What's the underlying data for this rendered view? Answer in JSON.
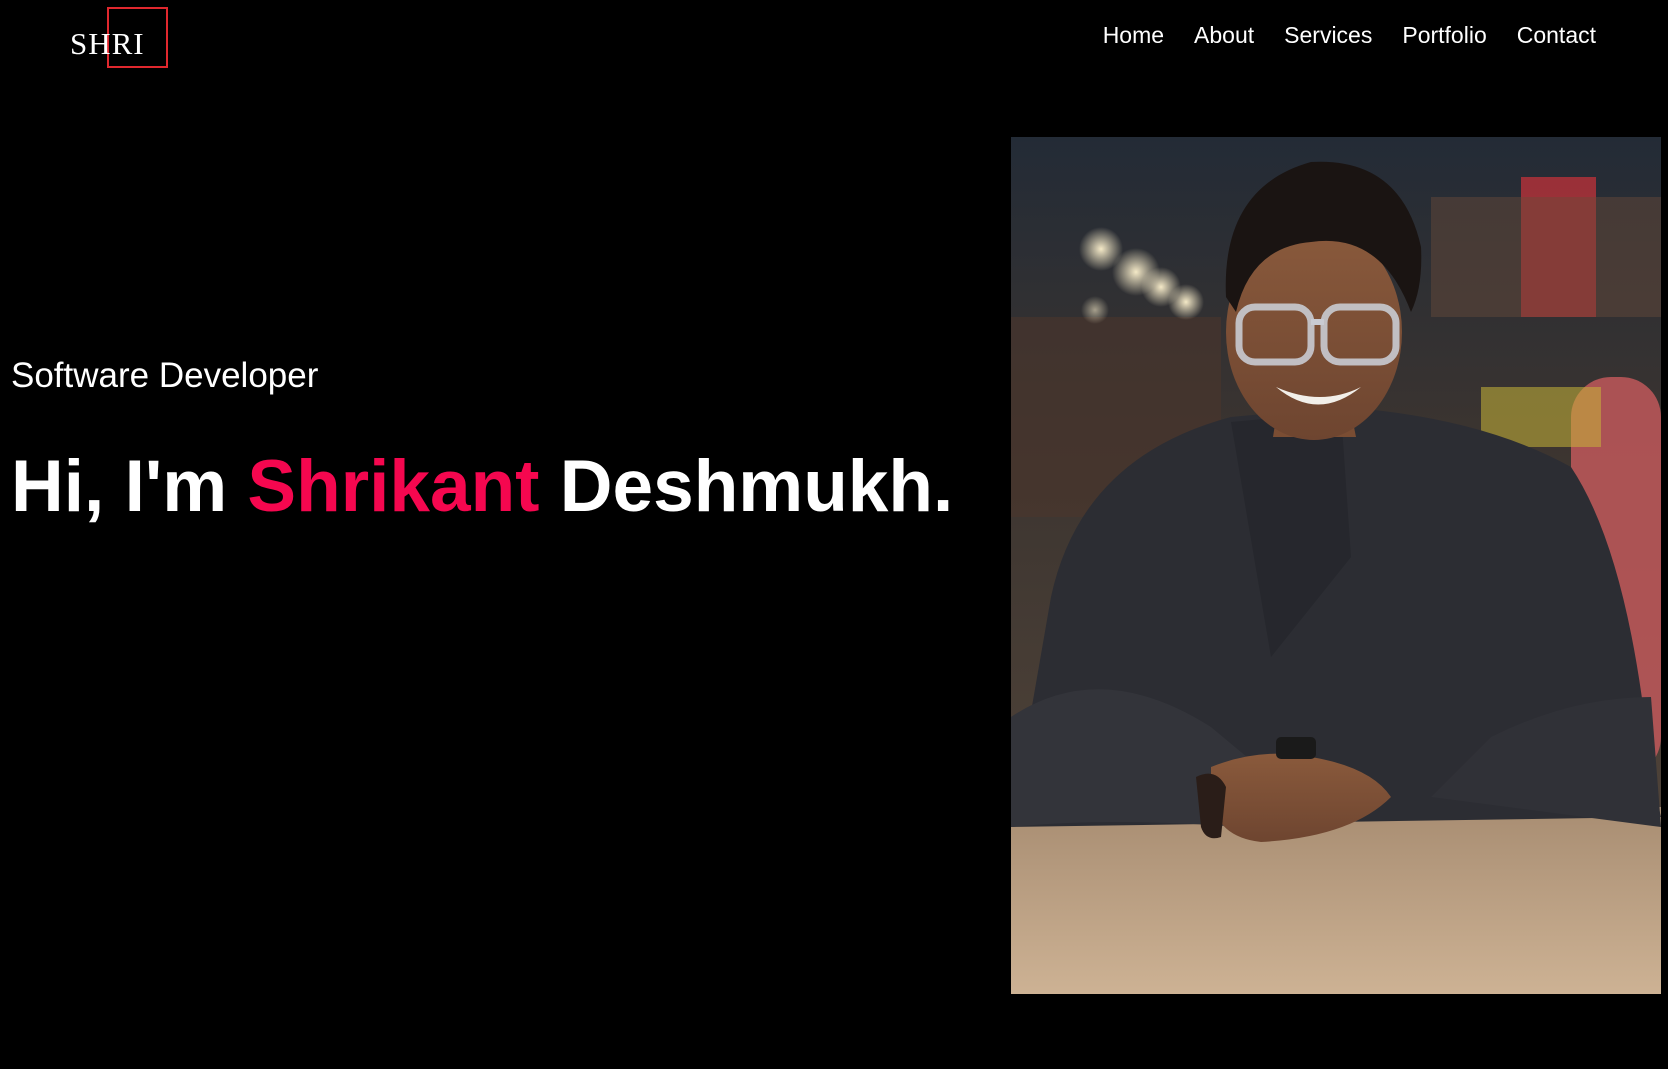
{
  "header": {
    "logo_text": "SHRI",
    "nav": [
      {
        "label": "Home"
      },
      {
        "label": "About"
      },
      {
        "label": "Services"
      },
      {
        "label": "Portfolio"
      },
      {
        "label": "Contact"
      }
    ]
  },
  "hero": {
    "subtitle": "Software Developer",
    "greeting": "Hi, I'm",
    "first_name": "Shrikant",
    "last_name": "Deshmukh."
  },
  "colors": {
    "background": "#000000",
    "accent": "#f5074f",
    "logo_border": "#e0282e",
    "text": "#ffffff"
  },
  "icons": {
    "profile_photo": "profile-photo"
  }
}
